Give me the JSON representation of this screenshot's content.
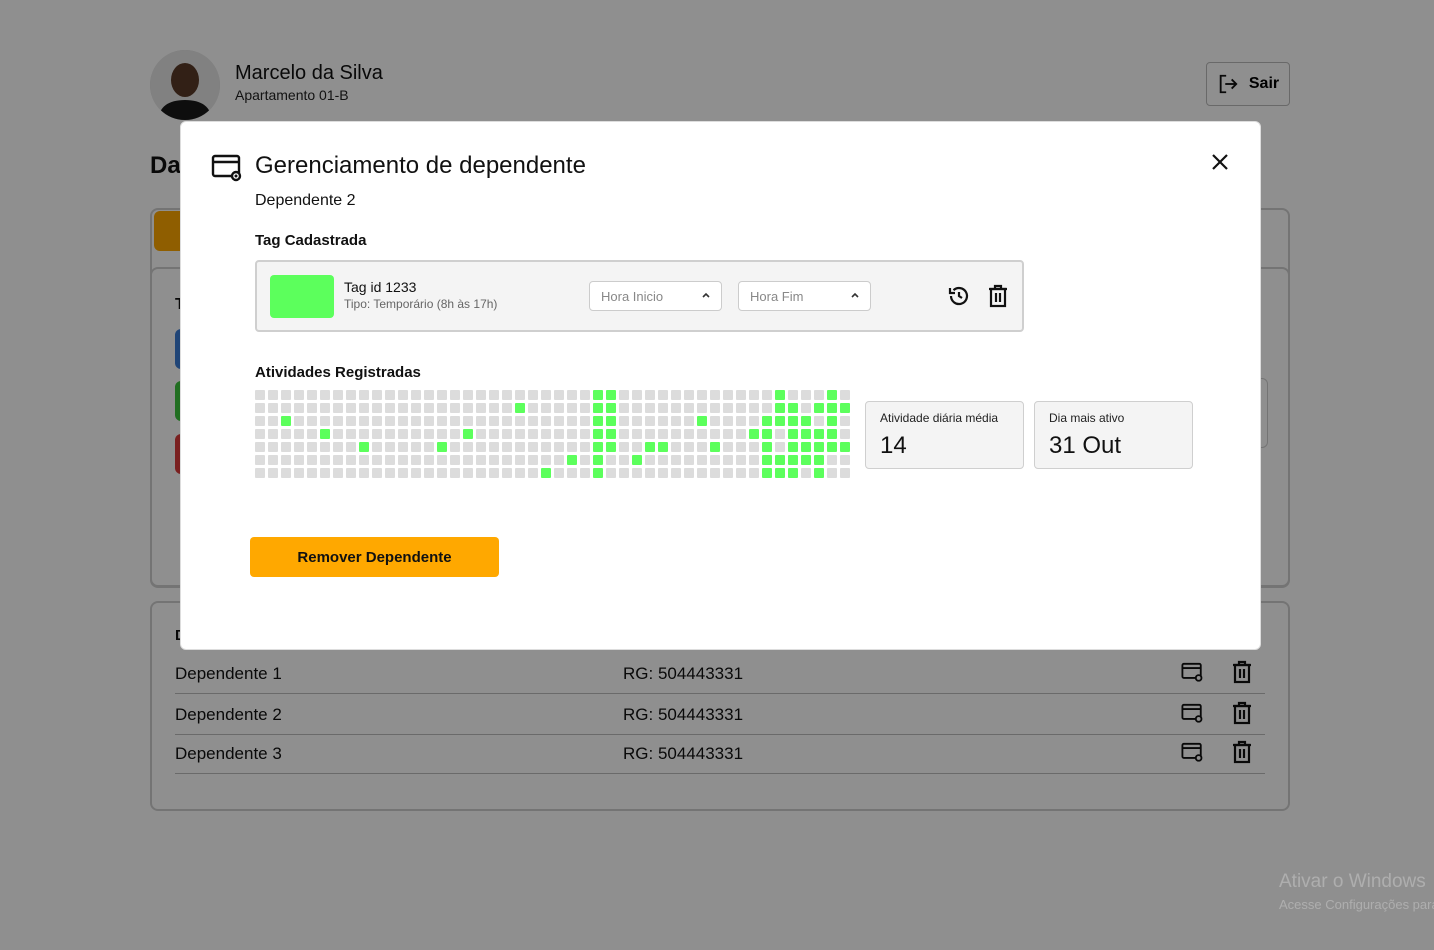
{
  "header": {
    "user_name": "Marcelo da Silva",
    "apartment": "Apartamento 01-B",
    "logout_label": "Sair"
  },
  "page": {
    "title_partial": "Da",
    "panel_label_partial": "T",
    "dependents_label_partial": "D"
  },
  "dependents": [
    {
      "name": "Dependente 1",
      "rg": "RG: 504443331"
    },
    {
      "name": "Dependente 2",
      "rg": "RG: 504443331"
    },
    {
      "name": "Dependente 3",
      "rg": "RG: 504443331"
    }
  ],
  "modal": {
    "title": "Gerenciamento de dependente",
    "subtitle": "Dependente 2",
    "tag_section_label": "Tag Cadastrada",
    "tag": {
      "id_label": "Tag id 1233",
      "type_label": "Tipo: Temporário (8h às 17h)",
      "color": "#5CFF5C",
      "start_placeholder": "Hora Inicio",
      "end_placeholder": "Hora Fim"
    },
    "activity_section_label": "Atividades Registradas",
    "stats": [
      {
        "label": "Atividade diária média",
        "value": "14"
      },
      {
        "label": "Dia mais ativo",
        "value": "31 Out"
      }
    ],
    "remove_label": "Remover Dependente"
  },
  "activity": {
    "weeks": 46,
    "days": 7,
    "active_color": "#5CFF5C",
    "inactive_color": "#DCDCDC",
    "active_cells": [
      [
        2,
        2
      ],
      [
        5,
        3
      ],
      [
        8,
        4
      ],
      [
        14,
        4
      ],
      [
        16,
        3
      ],
      [
        20,
        1
      ],
      [
        22,
        6
      ],
      [
        24,
        5
      ],
      [
        26,
        0
      ],
      [
        26,
        1
      ],
      [
        26,
        2
      ],
      [
        26,
        3
      ],
      [
        26,
        4
      ],
      [
        26,
        5
      ],
      [
        26,
        6
      ],
      [
        27,
        0
      ],
      [
        27,
        1
      ],
      [
        27,
        2
      ],
      [
        27,
        3
      ],
      [
        27,
        4
      ],
      [
        29,
        5
      ],
      [
        30,
        4
      ],
      [
        31,
        4
      ],
      [
        34,
        2
      ],
      [
        35,
        4
      ],
      [
        38,
        3
      ],
      [
        39,
        2
      ],
      [
        39,
        3
      ],
      [
        39,
        4
      ],
      [
        39,
        5
      ],
      [
        39,
        6
      ],
      [
        40,
        0
      ],
      [
        40,
        1
      ],
      [
        40,
        2
      ],
      [
        40,
        5
      ],
      [
        40,
        6
      ],
      [
        41,
        1
      ],
      [
        41,
        2
      ],
      [
        41,
        3
      ],
      [
        41,
        4
      ],
      [
        41,
        5
      ],
      [
        41,
        6
      ],
      [
        42,
        2
      ],
      [
        42,
        3
      ],
      [
        42,
        4
      ],
      [
        42,
        5
      ],
      [
        43,
        1
      ],
      [
        43,
        3
      ],
      [
        43,
        4
      ],
      [
        43,
        5
      ],
      [
        43,
        6
      ],
      [
        44,
        0
      ],
      [
        44,
        1
      ],
      [
        44,
        2
      ],
      [
        44,
        3
      ],
      [
        44,
        4
      ],
      [
        45,
        1
      ],
      [
        45,
        4
      ]
    ]
  },
  "watermark": {
    "line1": "Ativar o Windows",
    "line2": "Acesse Configurações para ativar o Windows."
  },
  "colors": {
    "accent": "#FFA800",
    "stripe_blue": "#3A7BD5",
    "stripe_green": "#3CC43C",
    "stripe_red": "#D93A3A"
  }
}
